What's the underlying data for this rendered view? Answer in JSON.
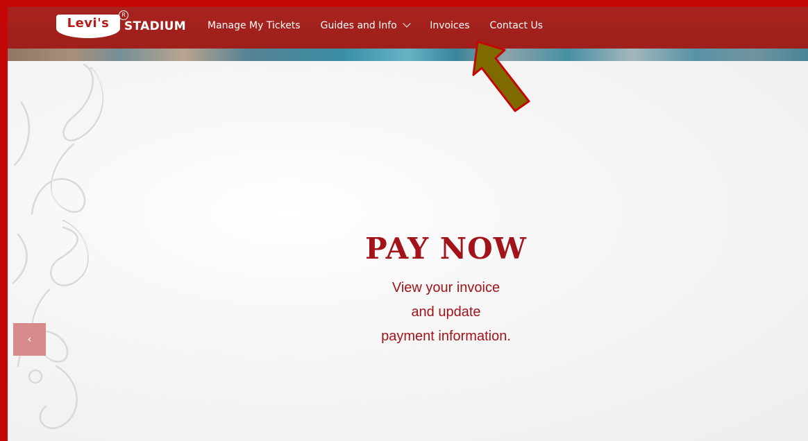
{
  "brand": {
    "logo_text": "Levi's",
    "logo_suffix": "STADIUM",
    "registered_mark": "R"
  },
  "nav": {
    "items": [
      {
        "label": "Manage My Tickets",
        "has_dropdown": false
      },
      {
        "label": "Guides and Info",
        "has_dropdown": true
      },
      {
        "label": "Invoices",
        "has_dropdown": false
      },
      {
        "label": "Contact Us",
        "has_dropdown": false
      }
    ]
  },
  "hero": {
    "title": "PAY NOW",
    "subtitle_lines": [
      "View your invoice",
      "and update",
      "payment information."
    ],
    "prev_button_glyph": "‹"
  },
  "annotation": {
    "arrow_target": "Invoices",
    "arrow_color": "#7d6a00",
    "arrow_outline": "#c40606"
  },
  "colors": {
    "frame_border": "#c40606",
    "navbar_bg": "#a8231e",
    "hero_text": "#a2131a",
    "prev_button_bg": "#d98b8b"
  }
}
